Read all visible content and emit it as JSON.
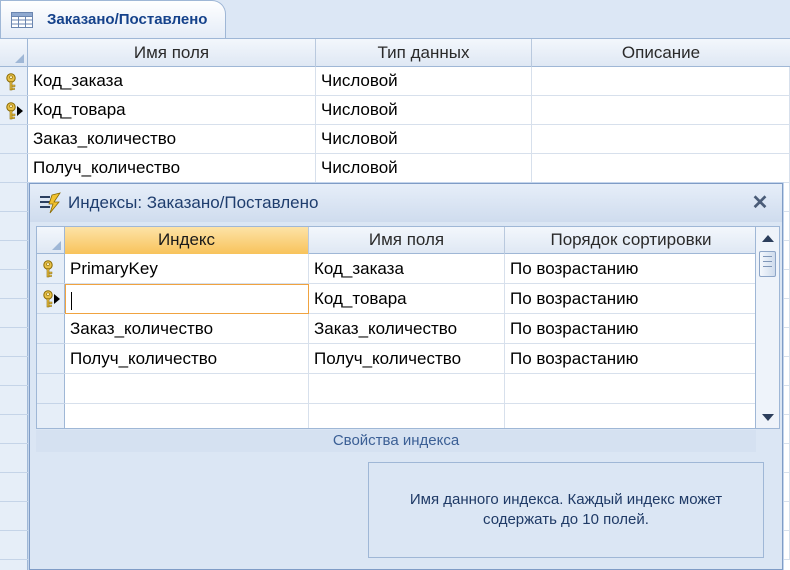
{
  "document_tab": {
    "title": "Заказано/Поставлено",
    "icon": "table-icon"
  },
  "design_grid": {
    "columns": [
      "Имя поля",
      "Тип данных",
      "Описание"
    ],
    "rows": [
      {
        "field": "Код_заказа",
        "type": "Числовой",
        "description": "",
        "primary_key": true,
        "current": false
      },
      {
        "field": "Код_товара",
        "type": "Числовой",
        "description": "",
        "primary_key": true,
        "current": true
      },
      {
        "field": "Заказ_количество",
        "type": "Числовой",
        "description": "",
        "primary_key": false,
        "current": false
      },
      {
        "field": "Получ_количество",
        "type": "Числовой",
        "description": "",
        "primary_key": false,
        "current": false
      }
    ]
  },
  "indexes_dialog": {
    "title": "Индексы: Заказано/Поставлено",
    "icon": "indexes-icon",
    "columns": [
      "Индекс",
      "Имя поля",
      "Порядок сортировки"
    ],
    "rows": [
      {
        "index": "PrimaryKey",
        "field": "Код_заказа",
        "order": "По возрастанию",
        "primary_key": true,
        "current": false
      },
      {
        "index": "",
        "field": "Код_товара",
        "order": "По возрастанию",
        "primary_key": true,
        "current": true
      },
      {
        "index": "Заказ_количество",
        "field": "Заказ_количество",
        "order": "По возрастанию",
        "primary_key": false,
        "current": false
      },
      {
        "index": "Получ_количество",
        "field": "Получ_количество",
        "order": "По возрастанию",
        "primary_key": false,
        "current": false
      },
      {
        "index": "",
        "field": "",
        "order": "",
        "primary_key": false,
        "current": false
      },
      {
        "index": "",
        "field": "",
        "order": "",
        "primary_key": false,
        "current": false
      }
    ],
    "properties_label": "Свойства индекса",
    "help_text": "Имя данного индекса.  Каждый индекс может содержать до 10 полей.",
    "close_glyph": "✕"
  },
  "colors": {
    "accent_header": "#f8c35b",
    "frame_blue": "#9fb7d6",
    "key_gold": "#c9a227"
  }
}
